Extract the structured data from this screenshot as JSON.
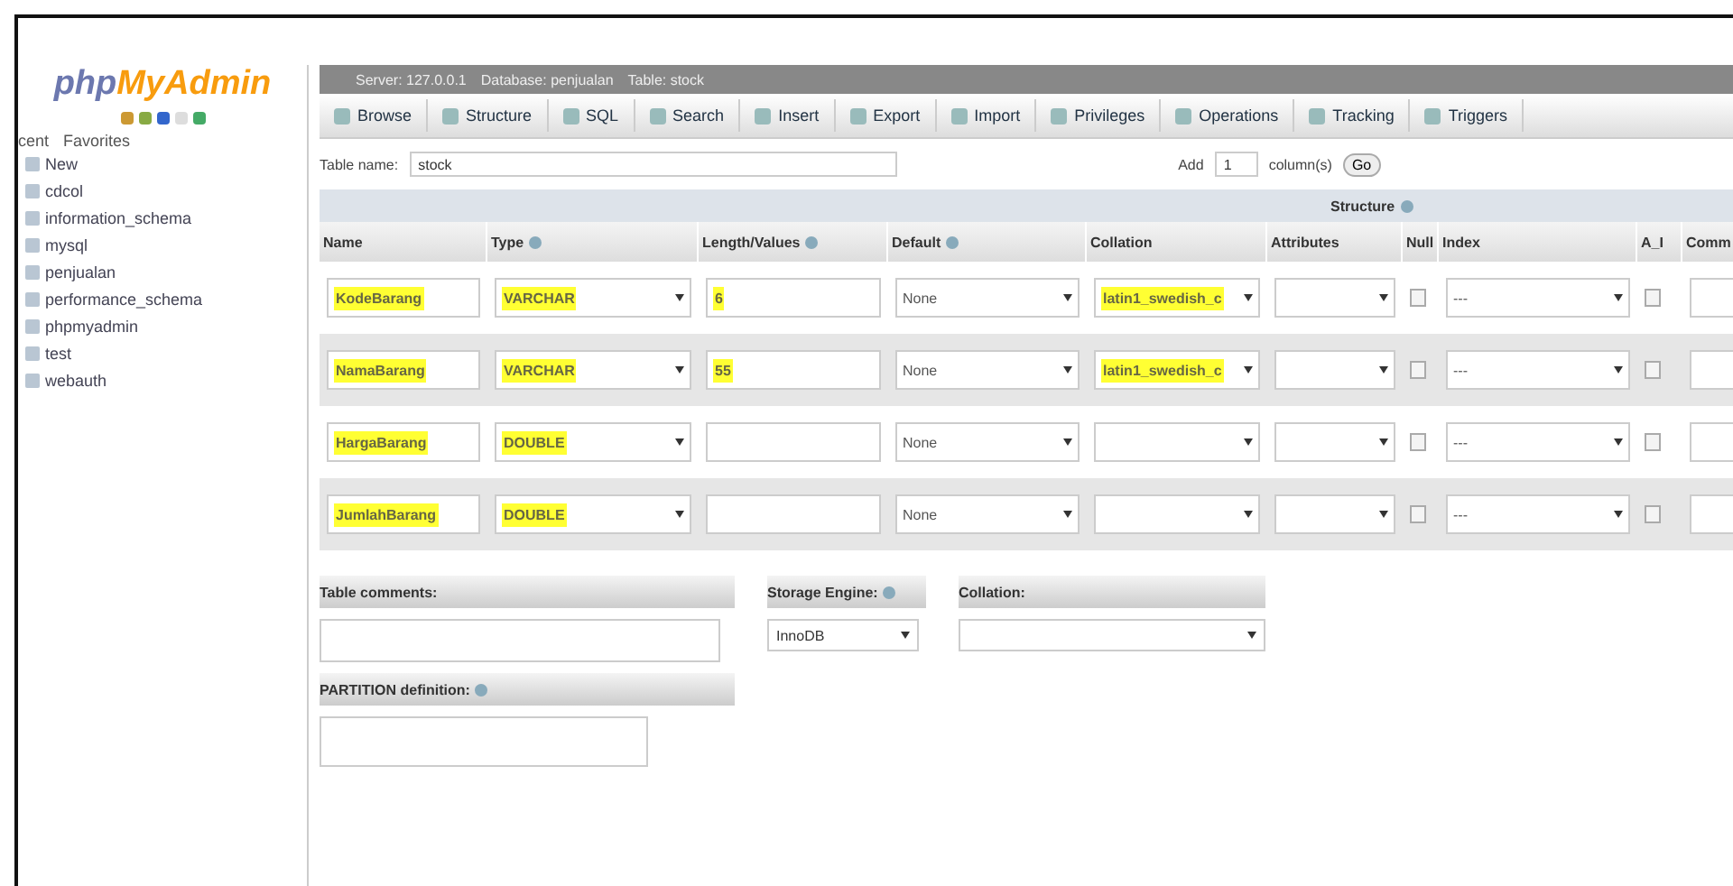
{
  "sidebar": {
    "logo_php": "php",
    "logo_rest": "MyAdmin",
    "tabs": [
      "cent",
      "Favorites"
    ],
    "items": [
      "New",
      "cdcol",
      "information_schema",
      "mysql",
      "penjualan",
      "performance_schema",
      "phpmyadmin",
      "test",
      "webauth"
    ]
  },
  "breadcrumb": [
    "Server: 127.0.0.1",
    "Database: penjualan",
    "Table: stock"
  ],
  "tabs": [
    "Browse",
    "Structure",
    "SQL",
    "Search",
    "Insert",
    "Export",
    "Import",
    "Privileges",
    "Operations",
    "Tracking",
    "Triggers"
  ],
  "table_name": {
    "label": "Table name:",
    "value": "stock",
    "add_label": "Add",
    "add_value": "1",
    "columns_label": "column(s)",
    "go": "Go"
  },
  "structure_label": "Structure",
  "columns": [
    "Name",
    "Type",
    "Length/Values",
    "Default",
    "Collation",
    "Attributes",
    "Null",
    "Index",
    "A_I",
    "Comm"
  ],
  "rows": [
    {
      "name": "KodeBarang",
      "type": "VARCHAR",
      "length": "6",
      "default": "None",
      "collation": "latin1_swedish_c",
      "index": "---",
      "null": false,
      "ai": false,
      "highlighted": true
    },
    {
      "name": "NamaBarang",
      "type": "VARCHAR",
      "length": "55",
      "default": "None",
      "collation": "latin1_swedish_c",
      "index": "---",
      "null": false,
      "ai": false,
      "highlighted": true
    },
    {
      "name": "HargaBarang",
      "type": "DOUBLE",
      "length": "",
      "default": "None",
      "collation": "",
      "index": "---",
      "null": false,
      "ai": false,
      "highlighted": true
    },
    {
      "name": "JumlahBarang",
      "type": "DOUBLE",
      "length": "",
      "default": "None",
      "collation": "",
      "index": "---",
      "null": false,
      "ai": false,
      "highlighted": true
    }
  ],
  "table_comments": "Table comments:",
  "storage_engine": {
    "label": "Storage Engine:",
    "value": "InnoDB"
  },
  "collation_label": "Collation:",
  "partition_label": "PARTITION definition:"
}
